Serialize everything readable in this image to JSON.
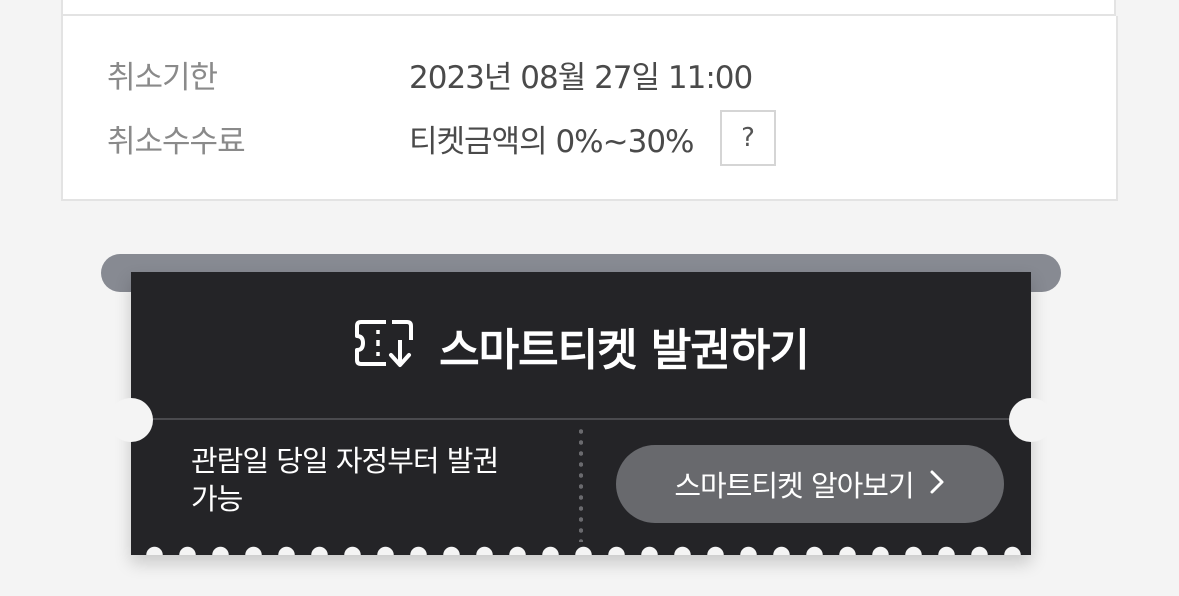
{
  "cancel_info": {
    "deadline_label": "취소기한",
    "deadline_value": "2023년 08월 27일 11:00",
    "fee_label": "취소수수료",
    "fee_value": "티켓금액의 0%~30%",
    "help_label": "?"
  },
  "smart_ticket": {
    "title": "스마트티켓 발권하기",
    "title_icon": "ticket-download-icon",
    "description": "관람일 당일 자정부터 발권 가능",
    "learn_more_label": "스마트티켓 알아보기",
    "learn_more_icon": "chevron-right-icon"
  },
  "colors": {
    "ticket_background": "#242427",
    "ticket_slot": "#878a92",
    "learn_button": "#68696d",
    "page_background": "#f4f4f4"
  }
}
